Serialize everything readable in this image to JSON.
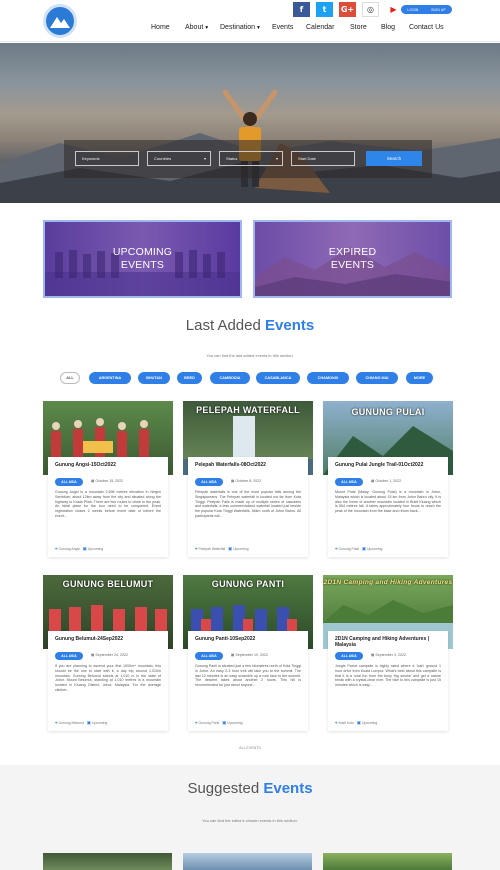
{
  "header": {
    "socials": [
      {
        "name": "facebook-icon",
        "glyph": "f",
        "color": "#3b5998"
      },
      {
        "name": "twitter-icon",
        "glyph": "t",
        "color": "#1da1f2"
      },
      {
        "name": "google-plus-icon",
        "glyph": "G+",
        "color": "#dd4b39"
      },
      {
        "name": "instagram-icon",
        "glyph": "◎",
        "color": "#c13584"
      },
      {
        "name": "youtube-icon",
        "glyph": "▶",
        "color": "#e62117"
      }
    ],
    "auth": {
      "login": "LOGIN",
      "signup": "SIGN UP"
    },
    "nav": {
      "home": "Home",
      "about": "About",
      "destination": "Destination",
      "events": "Events",
      "calendar": "Calendar",
      "store": "Store",
      "blog": "Blog",
      "contact": "Contact Us"
    }
  },
  "search": {
    "keywords": "Keywords",
    "countries": "Countries",
    "status": "Status",
    "start_date": "Start Date",
    "button": "Search"
  },
  "banners": {
    "upcoming": "UPCOMING\nEVENTS",
    "upcoming_line1": "UPCOMING",
    "upcoming_line2": "EVENTS",
    "expired_line1": "EXPIRED",
    "expired_line2": "EVENTS"
  },
  "last_added": {
    "title_plain": "Last Added",
    "title_accent": "Events",
    "subtitle": "You can find the last added events in this section.",
    "filters": [
      "ALL",
      "ARGENTINA",
      "BHUTAN",
      "BRED",
      "CAMBODIA",
      "CASABLANCA",
      "CHAMONIX",
      "CHIANG MAI",
      "MORE"
    ],
    "cards": [
      {
        "title": "Gunung Angsi-15Oct2022",
        "caption": "",
        "tag": "ALL ASIA",
        "date": "October 15, 2022",
        "desc": "Gunung Angsi is a mountain 2,698 metres elevation in Negeri Sembilan, about 12km away from the city and situated along the highway to Kuala Pilah. There are two routes to climb to the peak. An ideal place for the tour need to be conquered. Event registration closes 2 weeks before event date or before the event...",
        "location": "Gunung Angsi",
        "status": "Upcoming"
      },
      {
        "title": "Pelepah Waterfalls-08Oct2022",
        "caption": "PELEPAH WATERFALL",
        "tag": "ALL ASIA",
        "date": "October 8, 2022",
        "desc": "Pelepah waterfalls is one of the most popular falls among the Singaporeans. The Pelepah waterfall is located not far from Kota Tinggi. Pelepah Falls is made up of multiple series of cascades and waterfalls, a less commercialized waterfall located just beside the popular Kota Tinggi Waterfalls, 56km north of Johor Bahru. All participants will...",
        "location": "Pelepah Waterfall",
        "status": "Upcoming"
      },
      {
        "title": "Gunung Pulai Jungle Trail-01Oct2022",
        "caption": "GUNUNG PULAI",
        "tag": "ALL ASIA",
        "date": "October 1, 2022",
        "desc": "Mount Pulai (Malay: Gunung Pulai) is a mountain in Johor, Malaysia which is located about 15 km from Johor Bahru city. It is also the home of another mountain located in Bukit Kluang which is 564 metres tall. It takes approximately four hours to reach the peak of the mountain from the base and return back...",
        "location": "Gunung Pulai",
        "status": "Upcoming"
      },
      {
        "title": "Gunung Belumut-24Sep2022",
        "caption": "GUNUNG BELUMUT",
        "tag": "ALL ASIA",
        "date": "September 24, 2022",
        "desc": "If you are planning to ascend your first 1000m+ mountain, this should be the one to start with it, a day trip around 1,010m mountain. Gunung Belumut stands at 1,010 m in the state of Johor. Mount Belumut, standing at 1,010 metres is a mountain located in Kluang District, Johor, Malaysia. For the average climber...",
        "location": "Gunung Belumut",
        "status": "Upcoming"
      },
      {
        "title": "Gunung Panti-10Sep2022",
        "caption": "GUNUNG PANTI",
        "tag": "ALL ASIA",
        "date": "September 10, 2022",
        "desc": "Gunung Panti is situated just a few kilometres north of Kota Tinggi in Johor. An easy 2-3 hour trek will take you to the summit. The last 10 minutes is an easy scramble up a rock face to the summit. The descent takes about another 2 hours. This hill is recommended for just about anyone...",
        "location": "Gunung Panti",
        "status": "Upcoming"
      },
      {
        "title": "2D1N Camping and Hiking Adventures | Malaysia",
        "caption": "2D1N Camping and Hiking Adventures",
        "tag": "ALL ASIA",
        "date": "September 3, 2022",
        "desc": "Jungle Parrot campsite is highly rated where a 'lush' ground 1 hour drive from Kuala Lumpur. What's best about this campsite is that it is a rural fun from the busy 'big smoke' and get a nature break with a crystal-clear river. The hike to this campsite is just 15 minutes which is easy...",
        "location": "Bukit Kutu",
        "status": "Upcoming"
      }
    ],
    "all_events_link": "ALL EVENTS"
  },
  "suggested": {
    "title_plain": "Suggested",
    "title_accent": "Events",
    "subtitle": "You can find the editor's chosen events in this section."
  },
  "colors": {
    "accent": "#2f7fe6",
    "banner_border": "#9fb7ee"
  }
}
